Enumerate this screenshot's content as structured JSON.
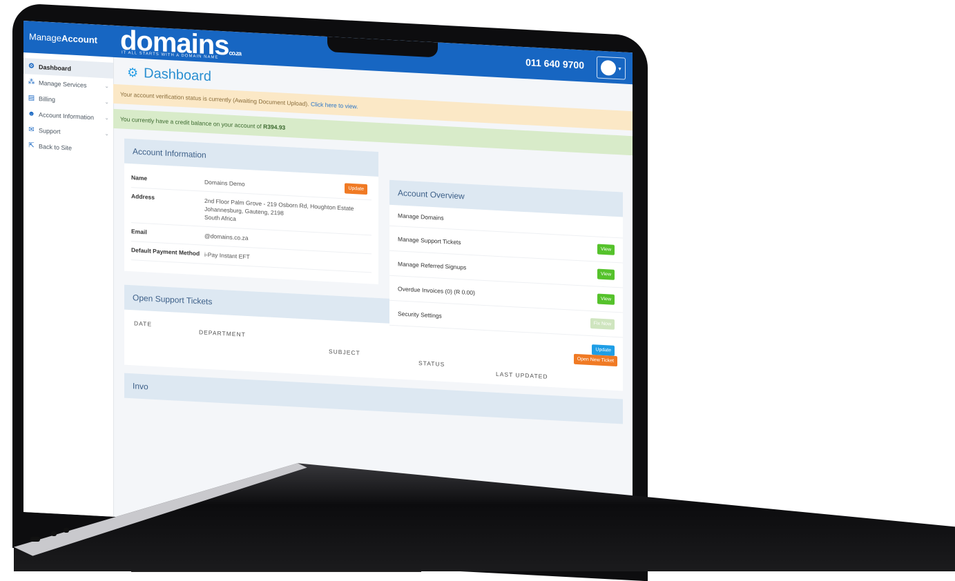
{
  "sidebar": {
    "brand_prefix": "Manage",
    "brand_suffix": "Account",
    "items": [
      {
        "label": "Dashboard",
        "icon": "gears-icon",
        "active": true
      },
      {
        "label": "Manage Services",
        "icon": "sitemap-icon"
      },
      {
        "label": "Billing",
        "icon": "card-icon"
      },
      {
        "label": "Account Information",
        "icon": "users-icon"
      },
      {
        "label": "Support",
        "icon": "chat-icon"
      },
      {
        "label": "Back to Site",
        "icon": "exit-icon"
      }
    ]
  },
  "header": {
    "logo": "domains",
    "logo_tld": "co.za",
    "tagline": "IT ALL STARTS WITH A DOMAIN NAME",
    "phone": "011 640 9700"
  },
  "main": {
    "title": "Dashboard",
    "alert_verification_text": "Your account verification status is currently (Awaiting Document Upload).",
    "alert_verification_link": "Click here to view.",
    "alert_credit_text": "You currently have a credit balance on your account of",
    "alert_credit_amount": "R394.93",
    "account_info": {
      "title": "Account Information",
      "update_label": "Update",
      "name_label": "Name",
      "name_value": "Domains Demo",
      "address_label": "Address",
      "address_line1": "2nd Floor Palm Grove - 219 Osborn Rd, Houghton Estate",
      "address_line2": "Johannesburg, Gauteng, 2198",
      "address_line3": "South Africa",
      "email_label": "Email",
      "email_value": "@domains.co.za",
      "payment_label": "Default Payment Method",
      "payment_value": "i-Pay Instant EFT"
    },
    "account_overview": {
      "title": "Account Overview",
      "rows": [
        {
          "label": "Manage Domains"
        },
        {
          "label": "Manage Support Tickets",
          "button": "View"
        },
        {
          "label": "Manage Referred Signups",
          "button": "View"
        },
        {
          "label": "Overdue Invoices (0) (R 0.00)",
          "button": "View"
        },
        {
          "label": "Security Settings",
          "button": "Fix Now"
        }
      ],
      "footer_button": "Update"
    },
    "support_tickets": {
      "title": "Open Support Tickets",
      "columns": [
        "DATE",
        "DEPARTMENT",
        "SUBJECT",
        "STATUS",
        "LAST UPDATED"
      ],
      "open_button": "Open New Ticket"
    },
    "invoices_title_partial": "Invo"
  }
}
